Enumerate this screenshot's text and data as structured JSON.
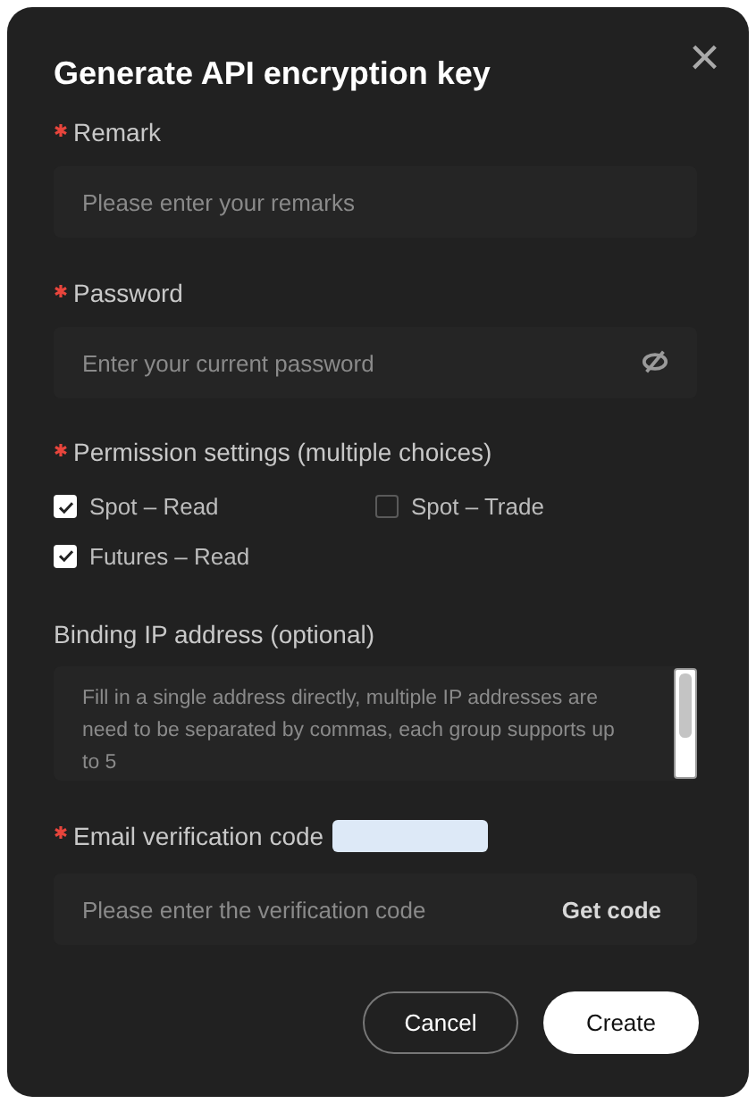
{
  "dialog": {
    "title": "Generate API encryption key",
    "close": "×"
  },
  "remark": {
    "label": "Remark",
    "required": true,
    "placeholder": "Please enter your remarks"
  },
  "password": {
    "label": "Password",
    "required": true,
    "placeholder": "Enter your current password"
  },
  "permissions": {
    "label": "Permission settings (multiple choices)",
    "required": true,
    "options": [
      {
        "label": "Spot – Read",
        "checked": true
      },
      {
        "label": "Spot – Trade",
        "checked": false
      },
      {
        "label": "Futures – Read",
        "checked": true
      }
    ]
  },
  "ip": {
    "label": "Binding IP address (optional)",
    "required": false,
    "placeholder": "Fill in a single address directly, multiple IP addresses are need to be separated by commas, each group supports up to 5"
  },
  "email_code": {
    "label": "Email verification code",
    "required": true,
    "placeholder": "Please enter the verification code",
    "action": "Get code"
  },
  "buttons": [
    {
      "label": "Cancel",
      "kind": "secondary"
    },
    {
      "label": "Create",
      "kind": "primary"
    }
  ]
}
